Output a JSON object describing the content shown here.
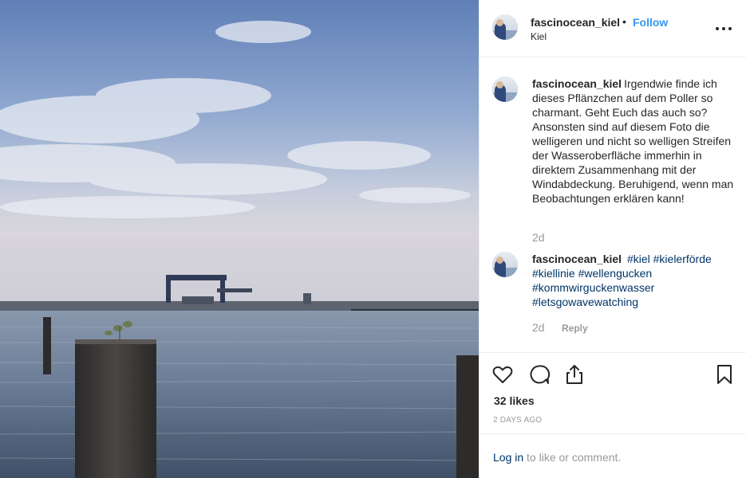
{
  "post": {
    "username": "fascinocean_kiel",
    "separator": "•",
    "follow_label": "Follow",
    "location": "Kiel",
    "more_label": "More options"
  },
  "caption": {
    "username": "fascinocean_kiel",
    "text": "Irgendwie finde ich dieses Pflänzchen auf dem Poller so charmant. Geht Euch das auch so? Ansonsten sind auf diesem Foto die welligeren und nicht so welligen Streifen der Wasseroberfläche immerhin in direktem Zusammenhang mit der Windabdeckung. Beruhigend, wenn man Beobachtungen erklären kann!",
    "time": "2d"
  },
  "comment": {
    "username": "fascinocean_kiel",
    "hashtags": [
      "#kiel",
      "#kielerförde",
      "#kiellinie",
      "#wellengucken",
      "#kommwirguckenwasser",
      "#letsgowavewatching"
    ],
    "time": "2d",
    "reply_label": "Reply"
  },
  "actions": {
    "icons": [
      "heart-icon",
      "comment-icon",
      "share-icon",
      "bookmark-icon"
    ],
    "likes": "32 likes",
    "posted_ago": "2 DAYS AGO"
  },
  "login": {
    "link_label": "Log in",
    "rest": "to like or comment."
  },
  "colors": {
    "accent": "#3897f0",
    "hashtag": "#003569",
    "muted": "#999999",
    "text": "#262626",
    "border": "#efefef"
  }
}
